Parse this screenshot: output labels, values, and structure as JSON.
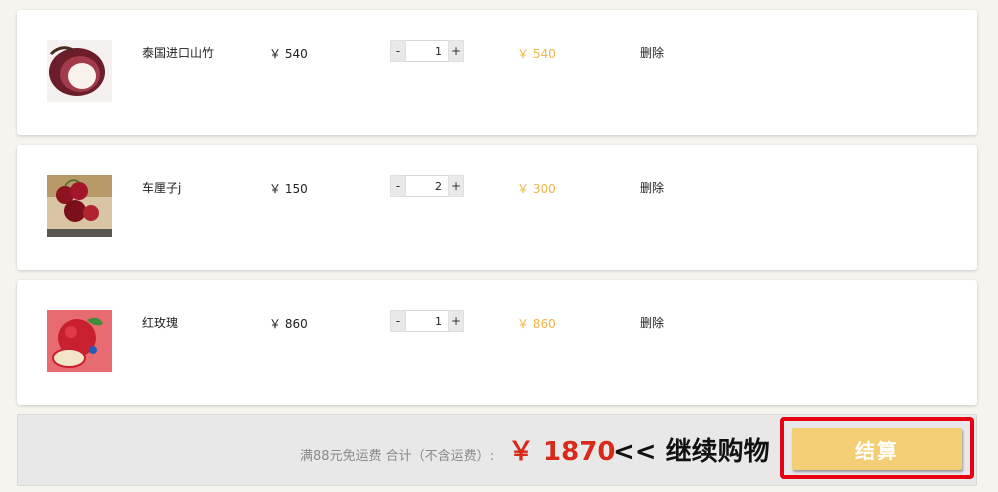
{
  "cart": {
    "items": [
      {
        "name": "泰国进口山竹",
        "price": "￥ 540",
        "quantity": "1",
        "subtotal": "￥ 540",
        "delete_label": "删除",
        "qty_minus": "-",
        "qty_plus": "+",
        "image_icon": "mangosteen-image"
      },
      {
        "name": "车厘子j",
        "price": "￥ 150",
        "quantity": "2",
        "subtotal": "￥ 300",
        "delete_label": "删除",
        "qty_minus": "-",
        "qty_plus": "+",
        "image_icon": "cherry-image"
      },
      {
        "name": "红玫瑰",
        "price": "￥ 860",
        "quantity": "1",
        "subtotal": "￥ 860",
        "delete_label": "删除",
        "qty_minus": "-",
        "qty_plus": "+",
        "image_icon": "apple-image"
      }
    ]
  },
  "footer": {
    "shipping_note": "满88元免运费 合计（不含运费）:",
    "total": "￥ 1870",
    "continue_label": "<< 继续购物",
    "checkout_label": "结算"
  },
  "colors": {
    "subtotal": "#f0b544",
    "total": "#d8291a",
    "checkout": "#f3ce74",
    "highlight_frame": "#e60012"
  }
}
